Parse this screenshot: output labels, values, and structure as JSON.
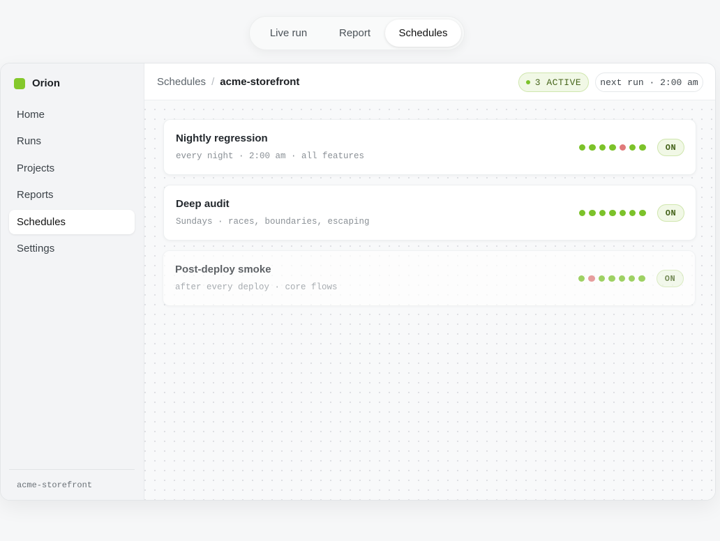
{
  "topnav": {
    "tabs": [
      {
        "label": "Live run"
      },
      {
        "label": "Report"
      },
      {
        "label": "Schedules",
        "selected": true
      }
    ]
  },
  "sidebar": {
    "brand": "Orion",
    "items": [
      {
        "label": "Home"
      },
      {
        "label": "Runs"
      },
      {
        "label": "Projects"
      },
      {
        "label": "Reports"
      },
      {
        "label": "Schedules",
        "active": true
      },
      {
        "label": "Settings"
      }
    ],
    "footer": "acme-storefront"
  },
  "header": {
    "breadcrumb_root": "Schedules",
    "breadcrumb_sep": "/",
    "breadcrumb_current": "acme-storefront",
    "active_badge": "3 ACTIVE",
    "next_run": "next run · 2:00 am"
  },
  "colors": {
    "accent": "#84c82b",
    "pass": "#7cc22a",
    "fail": "#e07a7a"
  },
  "schedules": [
    {
      "title": "Nightly regression",
      "subtitle": "every night · 2:00 am · all features",
      "history": [
        "pass",
        "pass",
        "pass",
        "pass",
        "fail",
        "pass",
        "pass"
      ],
      "toggle": "ON"
    },
    {
      "title": "Deep audit",
      "subtitle": "Sundays · races, boundaries, escaping",
      "history": [
        "pass",
        "pass",
        "pass",
        "pass",
        "pass",
        "pass",
        "pass"
      ],
      "toggle": "ON"
    },
    {
      "title": "Post-deploy smoke",
      "subtitle": "after every deploy · core flows",
      "history": [
        "pass",
        "fail",
        "pass",
        "pass",
        "pass",
        "pass",
        "pass"
      ],
      "toggle": "ON"
    }
  ]
}
